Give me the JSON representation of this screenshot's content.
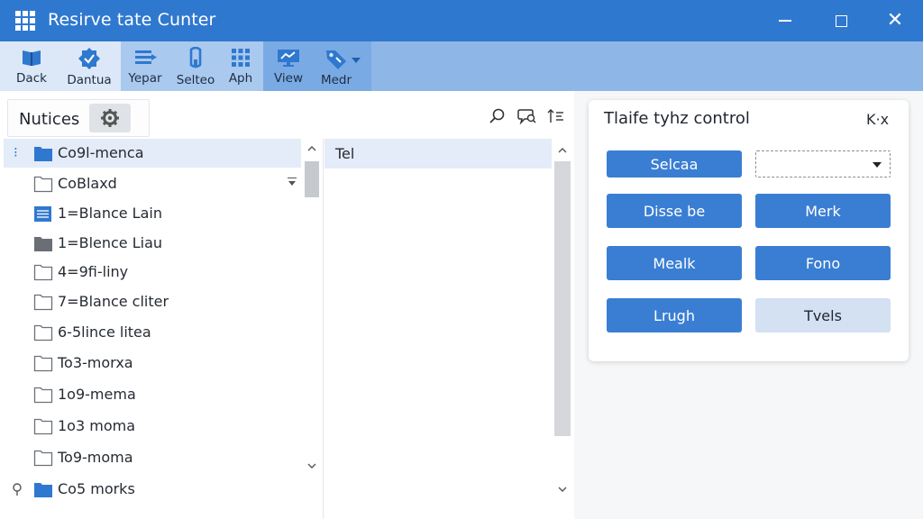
{
  "window": {
    "title": "Resirve  tate Cunter",
    "colors": {
      "titlebar": "#2f78cf",
      "accent": "#3a7ed3",
      "pale_button": "#d3e1f3"
    }
  },
  "ribbon": {
    "buttons": [
      {
        "label": "Dack",
        "icon": "book-icon"
      },
      {
        "label": "Dantua",
        "icon": "badge-check-icon"
      },
      {
        "label": "Yepar",
        "icon": "list-arrow-icon"
      },
      {
        "label": "Selteo",
        "icon": "clipboard-icon"
      },
      {
        "label": "Aph",
        "icon": "grid-dots-icon"
      },
      {
        "label": "View",
        "icon": "monitor-icon"
      },
      {
        "label": "Medr",
        "icon": "tag-icon"
      }
    ]
  },
  "left_panel": {
    "title": "Nutices",
    "tree": [
      {
        "label": "Co9l-menca",
        "icon": "folder-blue-icon",
        "selected": true
      },
      {
        "label": "CoBlaxd",
        "icon": "folder-outline-icon",
        "selected": false
      },
      {
        "label": "1=Blance Lain",
        "icon": "document-blue-icon",
        "selected": false
      },
      {
        "label": "1=Blence Liau",
        "icon": "folder-gray-icon",
        "selected": false
      },
      {
        "label": "4=9fi-liny",
        "icon": "folder-outline-icon",
        "selected": false
      },
      {
        "label": "7=Blance cliter",
        "icon": "folder-outline-icon",
        "selected": false
      },
      {
        "label": "6-5lince litea",
        "icon": "folder-outline-icon",
        "selected": false
      },
      {
        "label": "To3-morxa",
        "icon": "folder-outline-icon",
        "selected": false
      },
      {
        "label": "1o9-mema",
        "icon": "folder-outline-icon",
        "selected": false
      },
      {
        "label": "1o3 moma",
        "icon": "folder-outline-icon",
        "selected": false
      },
      {
        "label": "To9-moma",
        "icon": "folder-outline-icon",
        "selected": false
      },
      {
        "label": "Co5 morks",
        "icon": "folder-blue-icon",
        "selected": false
      }
    ],
    "column2_header": "Tel"
  },
  "card": {
    "title": "Tlaife tyhz control",
    "close_label": "K·x",
    "buttons": {
      "selcaa": "Selcaa",
      "disse_be": "Disse be",
      "merk": "Merk",
      "mealk": "Mealk",
      "fono": "Fono",
      "lrugh": "Lrugh",
      "tvels": "Tvels"
    },
    "dropdown_value": ""
  }
}
